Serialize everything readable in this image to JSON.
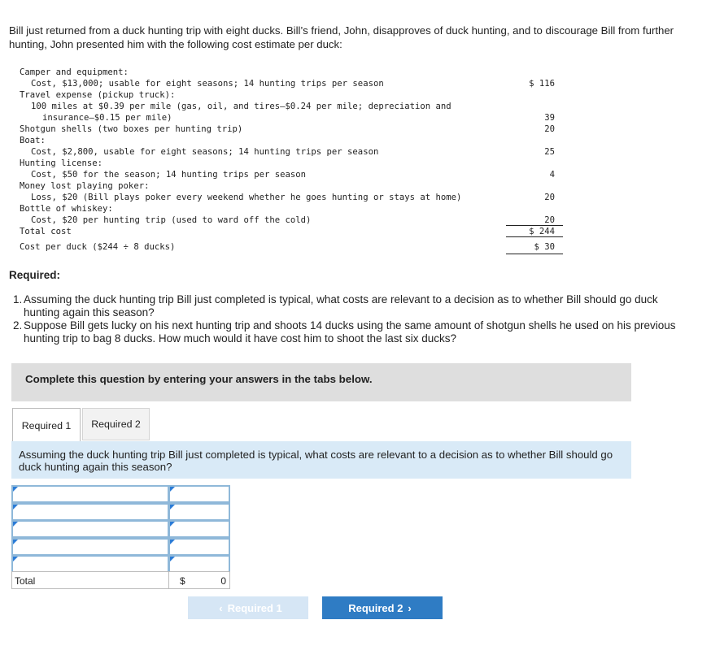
{
  "intro": "Bill just returned from a duck hunting trip with eight ducks. Bill’s friend, John, disapproves of duck hunting, and to discourage Bill from further hunting, John presented him with the following cost estimate per duck:",
  "estimate": {
    "lines": [
      {
        "text": "Camper and equipment:",
        "indent": 0
      },
      {
        "text": "Cost, $13,000; usable for eight seasons; 14 hunting trips per season",
        "indent": 1,
        "amount": "$ 116"
      },
      {
        "text": "Travel expense (pickup truck):",
        "indent": 0
      },
      {
        "text": "100 miles at $0.39 per mile (gas, oil, and tires—$0.24 per mile; depreciation and",
        "indent": 1
      },
      {
        "text": "insurance—$0.15 per mile)",
        "indent": 2,
        "amount": "39"
      },
      {
        "text": "Shotgun shells (two boxes per hunting trip)",
        "indent": 0,
        "amount": "20"
      },
      {
        "text": "Boat:",
        "indent": 0
      },
      {
        "text": "Cost, $2,800, usable for eight seasons; 14 hunting trips per season",
        "indent": 1,
        "amount": "25"
      },
      {
        "text": "Hunting license:",
        "indent": 0
      },
      {
        "text": "Cost, $50 for the season; 14 hunting trips per season",
        "indent": 1,
        "amount": "4"
      },
      {
        "text": "Money lost playing poker:",
        "indent": 0
      },
      {
        "text": "Loss, $20 (Bill plays poker every weekend whether he goes hunting or stays at home)",
        "indent": 1,
        "amount": "20"
      },
      {
        "text": "Bottle of whiskey:",
        "indent": 0
      },
      {
        "text": "Cost, $20 per hunting trip (used to ward off the cold)",
        "indent": 1,
        "amount": "20"
      },
      {
        "text": "Total cost",
        "indent": 0,
        "amount": "$ 244"
      },
      {
        "text": "Cost per duck ($244 ÷ 8 ducks)",
        "indent": 0,
        "amount": "$ 30"
      }
    ]
  },
  "required": {
    "heading": "Required:",
    "items": [
      {
        "num": "1.",
        "text": "Assuming the duck hunting trip Bill just completed is typical, what costs are relevant to a decision as to whether Bill should go duck hunting again this season?"
      },
      {
        "num": "2.",
        "text": "Suppose Bill gets lucky on his next hunting trip and shoots 14 ducks using the same amount of shotgun shells he used on his previous hunting trip to bag 8 ducks. How much would it have cost him to shoot the last six ducks?"
      }
    ]
  },
  "instruction": "Complete this question by entering your answers in the tabs below.",
  "tabs": [
    {
      "label": "Required 1",
      "active": true
    },
    {
      "label": "Required 2",
      "active": false
    }
  ],
  "question": "Assuming the duck hunting trip Bill just completed is typical, what costs are relevant to a decision as to whether Bill should go duck hunting again this season?",
  "answer_table": {
    "rows": [
      {
        "label": "",
        "value": ""
      },
      {
        "label": "",
        "value": ""
      },
      {
        "label": "",
        "value": ""
      },
      {
        "label": "",
        "value": ""
      },
      {
        "label": "",
        "value": ""
      }
    ],
    "total_label": "Total",
    "total_currency": "$",
    "total_value": "0"
  },
  "nav": {
    "prev_label": "Required 1",
    "next_label": "Required 2",
    "prev_icon": "‹",
    "next_icon": "›"
  }
}
